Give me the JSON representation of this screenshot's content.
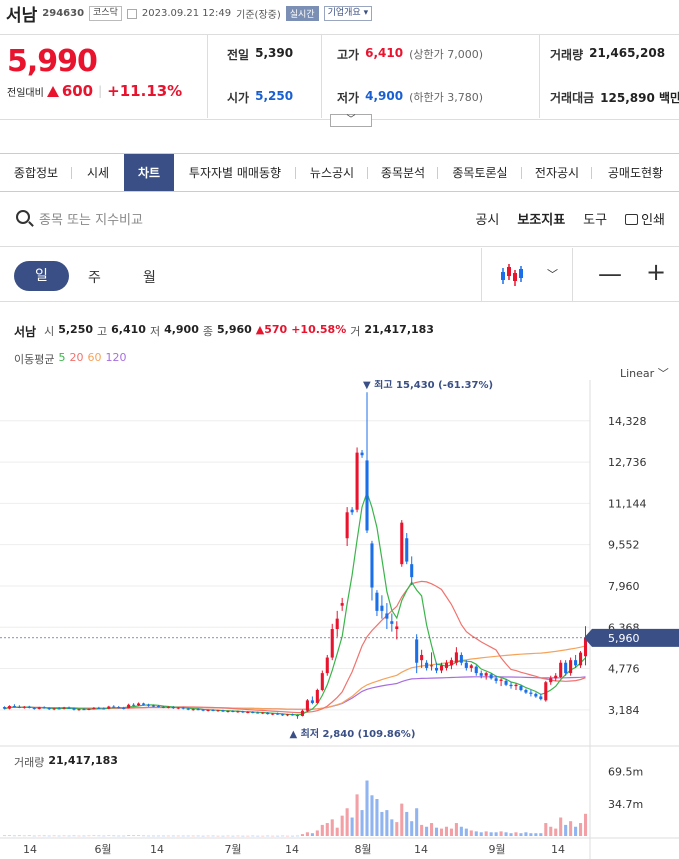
{
  "header": {
    "name": "서남",
    "code": "294630",
    "market": "코스닥",
    "datetime": "2023.09.21 12:49",
    "basis": "기준(장중)",
    "live_label": "실시간",
    "corp_label": "기업개요 ▾"
  },
  "price": {
    "now": "5,990",
    "compare_label": "전일대비",
    "change": "600",
    "change_rate": "+11.13%"
  },
  "stats": {
    "prev_label": "전일",
    "prev": "5,390",
    "high_label": "고가",
    "high": "6,410",
    "upper_limit": "(상한가 7,000)",
    "volume_label": "거래량",
    "volume": "21,465,208",
    "open_label": "시가",
    "open": "5,250",
    "low_label": "저가",
    "low": "4,900",
    "lower_limit": "(하한가 3,780)",
    "amount_label": "거래대금",
    "amount": "125,890 백만"
  },
  "tabs": [
    "종합정보",
    "시세",
    "차트",
    "투자자별 매매동향",
    "뉴스공시",
    "종목분석",
    "종목토론실",
    "전자공시",
    "공매도현황"
  ],
  "toolbar": {
    "search_placeholder": "종목 또는 지수비교",
    "disclosure": "공시",
    "indicator": "보조지표",
    "tools": "도구",
    "print": "인쇄"
  },
  "period": {
    "day": "일",
    "week": "주",
    "month": "월"
  },
  "info": {
    "name": "서남",
    "open_label": "시",
    "open": "5,250",
    "high_label": "고",
    "high": "6,410",
    "low_label": "저",
    "low": "4,900",
    "close_label": "종",
    "close": "5,960",
    "change": "▲570",
    "rate": "+10.58%",
    "vol_label": "거",
    "vol": "21,417,183"
  },
  "ma": {
    "label": "이동평균",
    "p5": "5",
    "p20": "20",
    "p60": "60",
    "p120": "120",
    "c5": "#3bb54a",
    "c20": "#f0736e",
    "c60": "#f5a35b",
    "c120": "#a86ee0"
  },
  "scale_label": "Linear",
  "volume_panel": {
    "label": "거래량",
    "value": "21,417,183",
    "ticks": [
      "69.5m",
      "34.7m"
    ]
  },
  "chart_data": {
    "type": "candlestick",
    "y_ticks": [
      14328,
      12736,
      11144,
      9552,
      7960,
      6368,
      4776,
      3184
    ],
    "y_tick_labels": [
      "14,328",
      "12,736",
      "11,144",
      "9,552",
      "7,960",
      "6,368",
      "4,776",
      "3,184"
    ],
    "ylim": [
      2600,
      15900
    ],
    "x_labels": [
      "14",
      "6월",
      "14",
      "7월",
      "14",
      "8월",
      "14",
      "9월",
      "14"
    ],
    "current_price": 5960,
    "current_price_label": "5,960",
    "max_label": "▼ 최고 15,430 (-61.37%)",
    "min_label": "▲ 최저 2,840 (109.86%)",
    "up_color": "#e8142e",
    "down_color": "#1a6fe8",
    "candles": [
      [
        3290,
        3320,
        3200,
        3230
      ],
      [
        3230,
        3360,
        3200,
        3330
      ],
      [
        3330,
        3400,
        3280,
        3300
      ],
      [
        3300,
        3360,
        3250,
        3270
      ],
      [
        3270,
        3330,
        3230,
        3310
      ],
      [
        3310,
        3340,
        3240,
        3260
      ],
      [
        3260,
        3290,
        3190,
        3220
      ],
      [
        3220,
        3300,
        3200,
        3280
      ],
      [
        3280,
        3320,
        3230,
        3250
      ],
      [
        3250,
        3280,
        3180,
        3210
      ],
      [
        3210,
        3260,
        3170,
        3240
      ],
      [
        3240,
        3290,
        3200,
        3230
      ],
      [
        3230,
        3300,
        3200,
        3270
      ],
      [
        3270,
        3310,
        3220,
        3250
      ],
      [
        3250,
        3270,
        3160,
        3190
      ],
      [
        3190,
        3230,
        3150,
        3210
      ],
      [
        3210,
        3250,
        3180,
        3200
      ],
      [
        3200,
        3240,
        3170,
        3220
      ],
      [
        3220,
        3290,
        3200,
        3260
      ],
      [
        3260,
        3300,
        3220,
        3240
      ],
      [
        3240,
        3280,
        3200,
        3230
      ],
      [
        3230,
        3340,
        3210,
        3310
      ],
      [
        3310,
        3360,
        3260,
        3290
      ],
      [
        3290,
        3330,
        3240,
        3260
      ],
      [
        3260,
        3300,
        3200,
        3250
      ],
      [
        3250,
        3420,
        3240,
        3380
      ],
      [
        3380,
        3440,
        3320,
        3360
      ],
      [
        3360,
        3470,
        3330,
        3430
      ],
      [
        3430,
        3460,
        3350,
        3380
      ],
      [
        3380,
        3420,
        3310,
        3350
      ],
      [
        3350,
        3390,
        3290,
        3330
      ],
      [
        3330,
        3370,
        3280,
        3300
      ],
      [
        3300,
        3340,
        3250,
        3280
      ],
      [
        3280,
        3320,
        3240,
        3300
      ],
      [
        3300,
        3330,
        3220,
        3250
      ],
      [
        3250,
        3290,
        3210,
        3270
      ],
      [
        3270,
        3300,
        3200,
        3230
      ],
      [
        3230,
        3260,
        3170,
        3200
      ],
      [
        3200,
        3240,
        3150,
        3210
      ],
      [
        3210,
        3250,
        3170,
        3190
      ],
      [
        3190,
        3220,
        3130,
        3160
      ],
      [
        3160,
        3200,
        3120,
        3180
      ],
      [
        3180,
        3210,
        3130,
        3150
      ],
      [
        3150,
        3190,
        3110,
        3170
      ],
      [
        3170,
        3190,
        3100,
        3120
      ],
      [
        3120,
        3160,
        3080,
        3140
      ],
      [
        3140,
        3170,
        3090,
        3110
      ],
      [
        3110,
        3150,
        3070,
        3130
      ],
      [
        3130,
        3150,
        3060,
        3090
      ],
      [
        3090,
        3130,
        3050,
        3100
      ],
      [
        3100,
        3130,
        3050,
        3080
      ],
      [
        3080,
        3120,
        3040,
        3060
      ],
      [
        3060,
        3100,
        3020,
        3080
      ],
      [
        3080,
        3100,
        3000,
        3020
      ],
      [
        3020,
        3060,
        2980,
        3040
      ],
      [
        3040,
        3080,
        2990,
        3010
      ],
      [
        3010,
        3040,
        2950,
        2990
      ],
      [
        2990,
        3030,
        2940,
        3010
      ],
      [
        3010,
        3040,
        2960,
        2980
      ],
      [
        2980,
        3010,
        2840,
        2950
      ],
      [
        2950,
        3200,
        2930,
        3150
      ],
      [
        3150,
        3600,
        3100,
        3550
      ],
      [
        3550,
        3700,
        3400,
        3450
      ],
      [
        3450,
        4000,
        3420,
        3950
      ],
      [
        3950,
        4700,
        3900,
        4600
      ],
      [
        4600,
        5300,
        4500,
        5200
      ],
      [
        5200,
        6500,
        5100,
        6300
      ],
      [
        6300,
        7000,
        6000,
        6700
      ],
      [
        7200,
        7500,
        7000,
        7300
      ],
      [
        9800,
        11000,
        9500,
        10800
      ],
      [
        10900,
        11000,
        10700,
        10800
      ],
      [
        10900,
        13300,
        10800,
        13100
      ],
      [
        13100,
        13200,
        12900,
        13000
      ],
      [
        12800,
        15430,
        10000,
        10100
      ],
      [
        9600,
        9700,
        7400,
        7900
      ],
      [
        7700,
        7800,
        6800,
        7000
      ],
      [
        7200,
        7600,
        6700,
        7000
      ],
      [
        6900,
        7300,
        6300,
        6700
      ],
      [
        6600,
        6900,
        6200,
        6500
      ],
      [
        6300,
        6600,
        5900,
        6400
      ],
      [
        8800,
        10500,
        8700,
        10400
      ],
      [
        9800,
        10000,
        8800,
        8900
      ],
      [
        8800,
        9100,
        8000,
        8300
      ],
      [
        5900,
        6100,
        4600,
        5000
      ],
      [
        5100,
        5500,
        4800,
        5300
      ],
      [
        5000,
        5100,
        4700,
        4800
      ],
      [
        4900,
        5400,
        4700,
        4900
      ],
      [
        4800,
        5000,
        4600,
        4700
      ],
      [
        4700,
        5000,
        4600,
        4900
      ],
      [
        4800,
        5100,
        4700,
        5000
      ],
      [
        4900,
        5200,
        4750,
        5100
      ],
      [
        5000,
        5600,
        4900,
        5400
      ],
      [
        5300,
        5400,
        4900,
        5000
      ],
      [
        5000,
        5100,
        4700,
        4800
      ],
      [
        4800,
        4950,
        4650,
        4900
      ],
      [
        4850,
        4900,
        4500,
        4600
      ],
      [
        4600,
        4700,
        4400,
        4500
      ],
      [
        4500,
        4650,
        4350,
        4600
      ],
      [
        4550,
        4600,
        4350,
        4400
      ],
      [
        4400,
        4500,
        4200,
        4300
      ],
      [
        4300,
        4400,
        4100,
        4350
      ],
      [
        4300,
        4380,
        4100,
        4150
      ],
      [
        4150,
        4250,
        4000,
        4100
      ],
      [
        4100,
        4200,
        3950,
        4150
      ],
      [
        4100,
        4150,
        3900,
        3950
      ],
      [
        3950,
        4000,
        3800,
        3850
      ],
      [
        3850,
        3950,
        3700,
        3800
      ],
      [
        3800,
        3850,
        3650,
        3700
      ],
      [
        3700,
        3800,
        3550,
        3600
      ],
      [
        3550,
        4300,
        3500,
        4250
      ],
      [
        4250,
        4500,
        4150,
        4400
      ],
      [
        4400,
        4600,
        4300,
        4500
      ],
      [
        4450,
        5100,
        4400,
        5000
      ],
      [
        5000,
        5100,
        4500,
        4600
      ],
      [
        4600,
        5200,
        4500,
        5100
      ],
      [
        5100,
        5300,
        4800,
        4900
      ],
      [
        4900,
        5450,
        4800,
        5390
      ],
      [
        5250,
        6410,
        4900,
        5960
      ]
    ],
    "volumes_m": [
      0.5,
      0.6,
      0.4,
      0.5,
      0.4,
      0.5,
      0.3,
      0.4,
      0.4,
      0.3,
      0.4,
      0.3,
      0.4,
      0.3,
      0.4,
      0.3,
      0.3,
      0.4,
      0.5,
      0.4,
      0.3,
      0.5,
      0.4,
      0.3,
      0.3,
      0.7,
      0.5,
      0.6,
      0.4,
      0.3,
      0.3,
      0.3,
      0.3,
      0.3,
      0.3,
      0.3,
      0.3,
      0.3,
      0.3,
      0.3,
      0.2,
      0.3,
      0.3,
      0.2,
      0.2,
      0.3,
      0.2,
      0.3,
      0.2,
      0.2,
      0.3,
      0.2,
      0.2,
      0.3,
      0.2,
      0.2,
      0.3,
      0.2,
      0.2,
      0.3,
      2,
      4,
      3,
      6,
      12,
      14,
      18,
      9,
      22,
      30,
      20,
      45,
      28,
      60,
      44,
      40,
      26,
      28,
      18,
      15,
      35,
      26,
      16,
      30,
      12,
      10,
      14,
      9,
      8,
      10,
      8,
      14,
      10,
      8,
      6,
      5,
      4,
      5,
      4,
      4,
      5,
      4,
      3,
      4,
      3,
      4,
      3,
      3,
      3,
      14,
      10,
      8,
      20,
      12,
      16,
      10,
      14,
      24
    ]
  }
}
